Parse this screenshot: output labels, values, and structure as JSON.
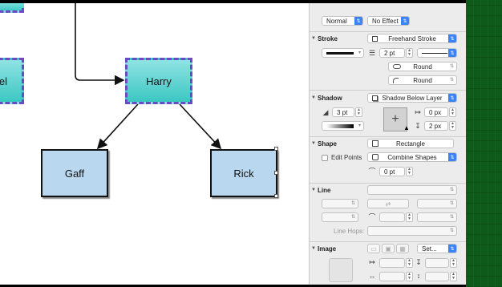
{
  "canvas": {
    "nodes": {
      "partial_left": "el",
      "harry": "Harry",
      "gaff": "Gaff",
      "rick": "Rick"
    }
  },
  "inspector": {
    "top": {
      "blend_mode": "Normal",
      "effect": "No Effect"
    },
    "stroke": {
      "title": "Stroke",
      "style": "Freehand Stroke",
      "width": "2 pt",
      "corner": "Round",
      "cap": "Round"
    },
    "shadow": {
      "title": "Shadow",
      "layer": "Shadow Below Layer",
      "size": "3 pt",
      "offset_x": "0 px",
      "offset_y": "2 px"
    },
    "shape": {
      "title": "Shape",
      "type": "Rectangle",
      "edit_points": "Edit Points",
      "combine": "Combine Shapes",
      "corner_radius": "0 pt"
    },
    "line": {
      "title": "Line",
      "line_hops": "Line Hops:"
    },
    "image": {
      "title": "Image",
      "set_button": "Set..."
    }
  },
  "colors": {
    "accent": "#3b82f6",
    "node_border_selected": "#6a4bc4",
    "node_fill_teal": "#3cc7c3",
    "node_fill_blue": "#b9d7ee",
    "desktop": "#0d5a1a"
  }
}
